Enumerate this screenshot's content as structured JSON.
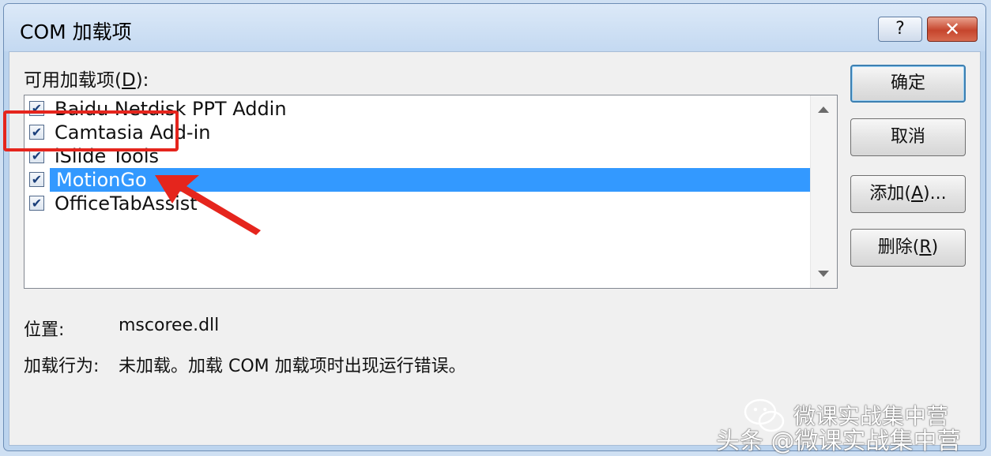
{
  "window": {
    "title": "COM 加载项",
    "help_label": "?",
    "close_label": "✕"
  },
  "list": {
    "label_prefix": "可用加载项(",
    "label_key": "D",
    "label_suffix": "):",
    "items": [
      {
        "label": "Baidu Netdisk PPT Addin",
        "checked": "✔"
      },
      {
        "label": "Camtasia Add-in",
        "checked": "✔"
      },
      {
        "label": "iSlide Tools",
        "checked": "✔"
      },
      {
        "label": "MotionGo",
        "checked": "✔"
      },
      {
        "label": "OfficeTabAssist",
        "checked": "✔"
      }
    ]
  },
  "buttons": {
    "ok": "确定",
    "cancel": "取消",
    "add_prefix": "添加(",
    "add_key": "A",
    "add_suffix": ")...",
    "remove_prefix": "删除(",
    "remove_key": "R",
    "remove_suffix": ")"
  },
  "details": {
    "location_label": "位置:",
    "location_value": "mscoree.dll",
    "behavior_label": "加载行为:",
    "behavior_value": "未加载。加载 COM 加载项时出现运行错误。"
  },
  "watermark": {
    "line1": "微课实战集中营",
    "line2": "头条 @微课实战集中营"
  },
  "colors": {
    "selection": "#3399ff",
    "annotation": "#e5251d"
  }
}
